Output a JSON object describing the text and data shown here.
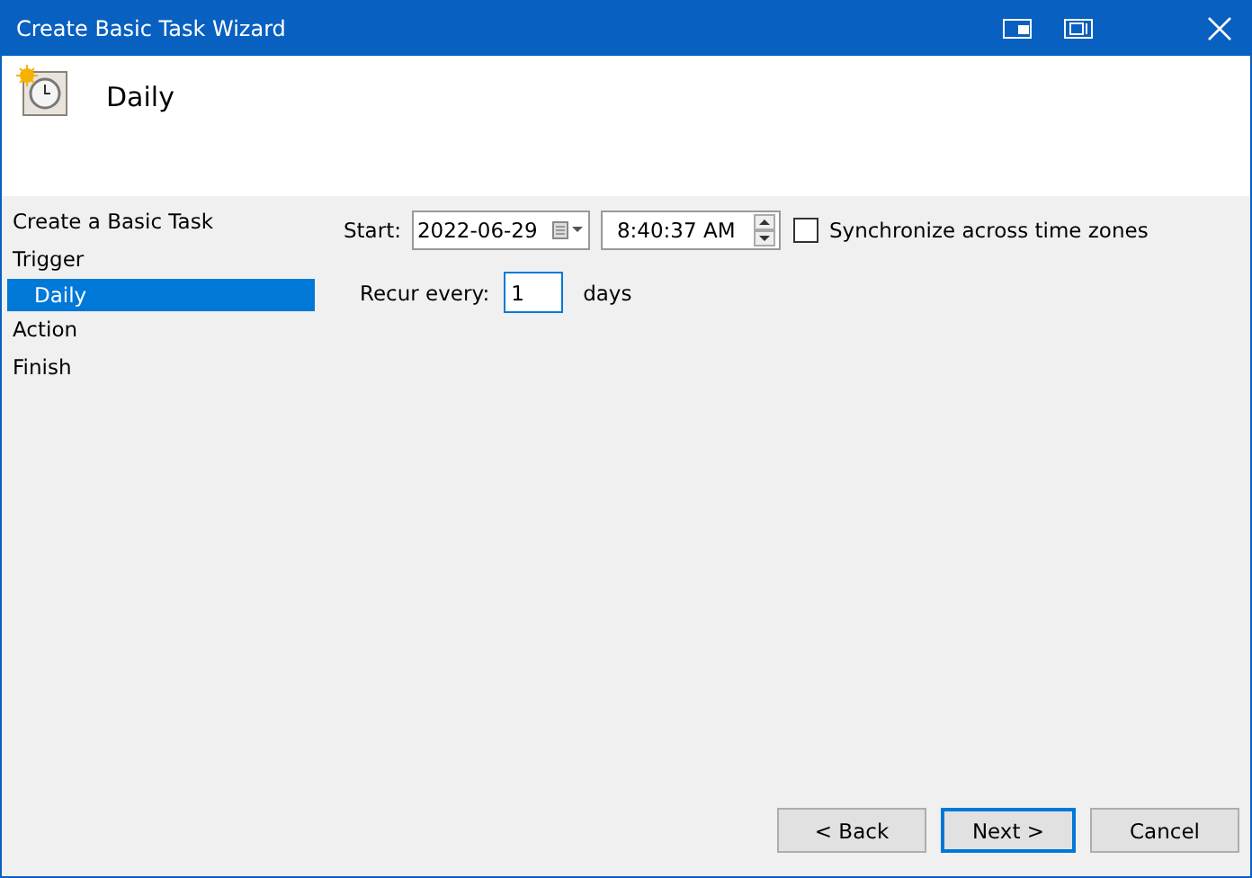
{
  "window": {
    "title": "Create Basic Task Wizard"
  },
  "header": {
    "title": "Daily"
  },
  "steps": [
    {
      "label": "Create a Basic Task",
      "selected": false
    },
    {
      "label": "Trigger",
      "selected": false,
      "children": [
        {
          "label": "Daily",
          "selected": true
        }
      ]
    },
    {
      "label": "Action",
      "selected": false
    },
    {
      "label": "Finish",
      "selected": false
    }
  ],
  "start": {
    "label": "Start:",
    "date": "2022-06-29",
    "time": "8:40:37 AM",
    "sync_label": "Synchronize across time zones",
    "sync_checked": false
  },
  "recur": {
    "label": "Recur every:",
    "value": "1",
    "unit": "days"
  },
  "buttons": [
    {
      "label": "< Back",
      "default": false
    },
    {
      "label": "Next >",
      "default": true
    },
    {
      "label": "Cancel",
      "default": false
    }
  ]
}
